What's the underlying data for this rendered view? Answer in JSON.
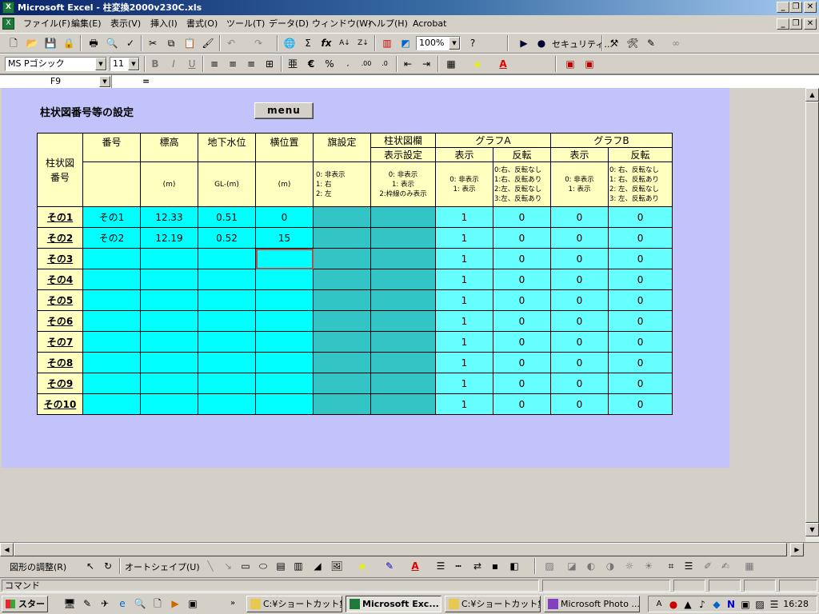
{
  "window": {
    "title": "Microsoft Excel - 柱変換2000v230C.xls",
    "app_icon": "excel-icon",
    "controls": [
      "_",
      "❐",
      "✕"
    ]
  },
  "menubar": {
    "items": [
      "ファイル(F)",
      "編集(E)",
      "表示(V)",
      "挿入(I)",
      "書式(O)",
      "ツール(T)",
      "データ(D)",
      "ウィンドウ(W)",
      "ヘルプ(H)",
      "Acrobat"
    ]
  },
  "toolbar": {
    "zoom": "100%",
    "macro_label": "セキュリティ..."
  },
  "format_toolbar": {
    "font_name": "MS Pゴシック",
    "font_size": "11",
    "bold": "B",
    "italic": "I",
    "underline": "U",
    "currency": "€",
    "percent": "%"
  },
  "formula_bar": {
    "name_box": "F9",
    "equals": "=",
    "content": ""
  },
  "sheet": {
    "title": "柱状図番号等の設定",
    "menu_button": "menu",
    "headers": {
      "col_label": "柱状図\n番号",
      "number": "番号",
      "elevation": "標高",
      "groundwater": "地下水位",
      "horizontal": "横位置",
      "flag": "旗設定",
      "column_cell": "柱状図欄",
      "display_setting": "表示設定",
      "graph_a": "グラフA",
      "graph_b": "グラフB",
      "display": "表示",
      "reverse": "反転"
    },
    "units": {
      "elevation": "(m)",
      "groundwater": "GL-(m)",
      "horizontal": "(m)"
    },
    "notes": {
      "flag": [
        "0: 非表示",
        "1: 右",
        "2: 左"
      ],
      "column_display": [
        "0: 非表示",
        "1: 表示",
        "2:枠線のみ表示"
      ],
      "graph_display": [
        "0: 非表示",
        "1: 表示"
      ],
      "graph_a_reverse": [
        "0:右、反転なし",
        "1:右、反転あり",
        "2:左、反転なし",
        "3:左、反転あり"
      ],
      "graph_b_reverse": [
        "0: 右、反転なし",
        "1: 右、反転あり",
        "2: 左、反転なし",
        "3: 左、反転あり"
      ]
    },
    "rows": [
      {
        "label": "その1",
        "number": "その1",
        "elevation": "12.33",
        "groundwater": "0.51",
        "horizontal": "0",
        "a_disp": "1",
        "a_rev": "0",
        "b_disp": "0",
        "b_rev": "0"
      },
      {
        "label": "その2",
        "number": "その2",
        "elevation": "12.19",
        "groundwater": "0.52",
        "horizontal": "15",
        "a_disp": "1",
        "a_rev": "0",
        "b_disp": "0",
        "b_rev": "0"
      },
      {
        "label": "その3",
        "number": "",
        "elevation": "",
        "groundwater": "",
        "horizontal": "",
        "a_disp": "1",
        "a_rev": "0",
        "b_disp": "0",
        "b_rev": "0"
      },
      {
        "label": "その4",
        "number": "",
        "elevation": "",
        "groundwater": "",
        "horizontal": "",
        "a_disp": "1",
        "a_rev": "0",
        "b_disp": "0",
        "b_rev": "0"
      },
      {
        "label": "その5",
        "number": "",
        "elevation": "",
        "groundwater": "",
        "horizontal": "",
        "a_disp": "1",
        "a_rev": "0",
        "b_disp": "0",
        "b_rev": "0"
      },
      {
        "label": "その6",
        "number": "",
        "elevation": "",
        "groundwater": "",
        "horizontal": "",
        "a_disp": "1",
        "a_rev": "0",
        "b_disp": "0",
        "b_rev": "0"
      },
      {
        "label": "その7",
        "number": "",
        "elevation": "",
        "groundwater": "",
        "horizontal": "",
        "a_disp": "1",
        "a_rev": "0",
        "b_disp": "0",
        "b_rev": "0"
      },
      {
        "label": "その8",
        "number": "",
        "elevation": "",
        "groundwater": "",
        "horizontal": "",
        "a_disp": "1",
        "a_rev": "0",
        "b_disp": "0",
        "b_rev": "0"
      },
      {
        "label": "その9",
        "number": "",
        "elevation": "",
        "groundwater": "",
        "horizontal": "",
        "a_disp": "1",
        "a_rev": "0",
        "b_disp": "0",
        "b_rev": "0"
      },
      {
        "label": "その10",
        "number": "",
        "elevation": "",
        "groundwater": "",
        "horizontal": "",
        "a_disp": "1",
        "a_rev": "0",
        "b_disp": "0",
        "b_rev": "0"
      }
    ],
    "colors": {
      "canvas": "#c3c3fb",
      "header": "#ffffc0",
      "cyan": "#00ffff",
      "teal": "#33c5c5",
      "light_cyan": "#66ffff"
    }
  },
  "drawing_toolbar": {
    "adjust": "図形の調整(R)",
    "autoshape": "オートシェイプ(U)"
  },
  "status": {
    "mode": "コマンド"
  },
  "taskbar": {
    "start": "スタート",
    "tasks": [
      "C:¥ショートカット集...",
      "Microsoft Exc...",
      "C:¥ショートカット集...",
      "Microsoft Photo ..."
    ],
    "clock": "16:28"
  }
}
